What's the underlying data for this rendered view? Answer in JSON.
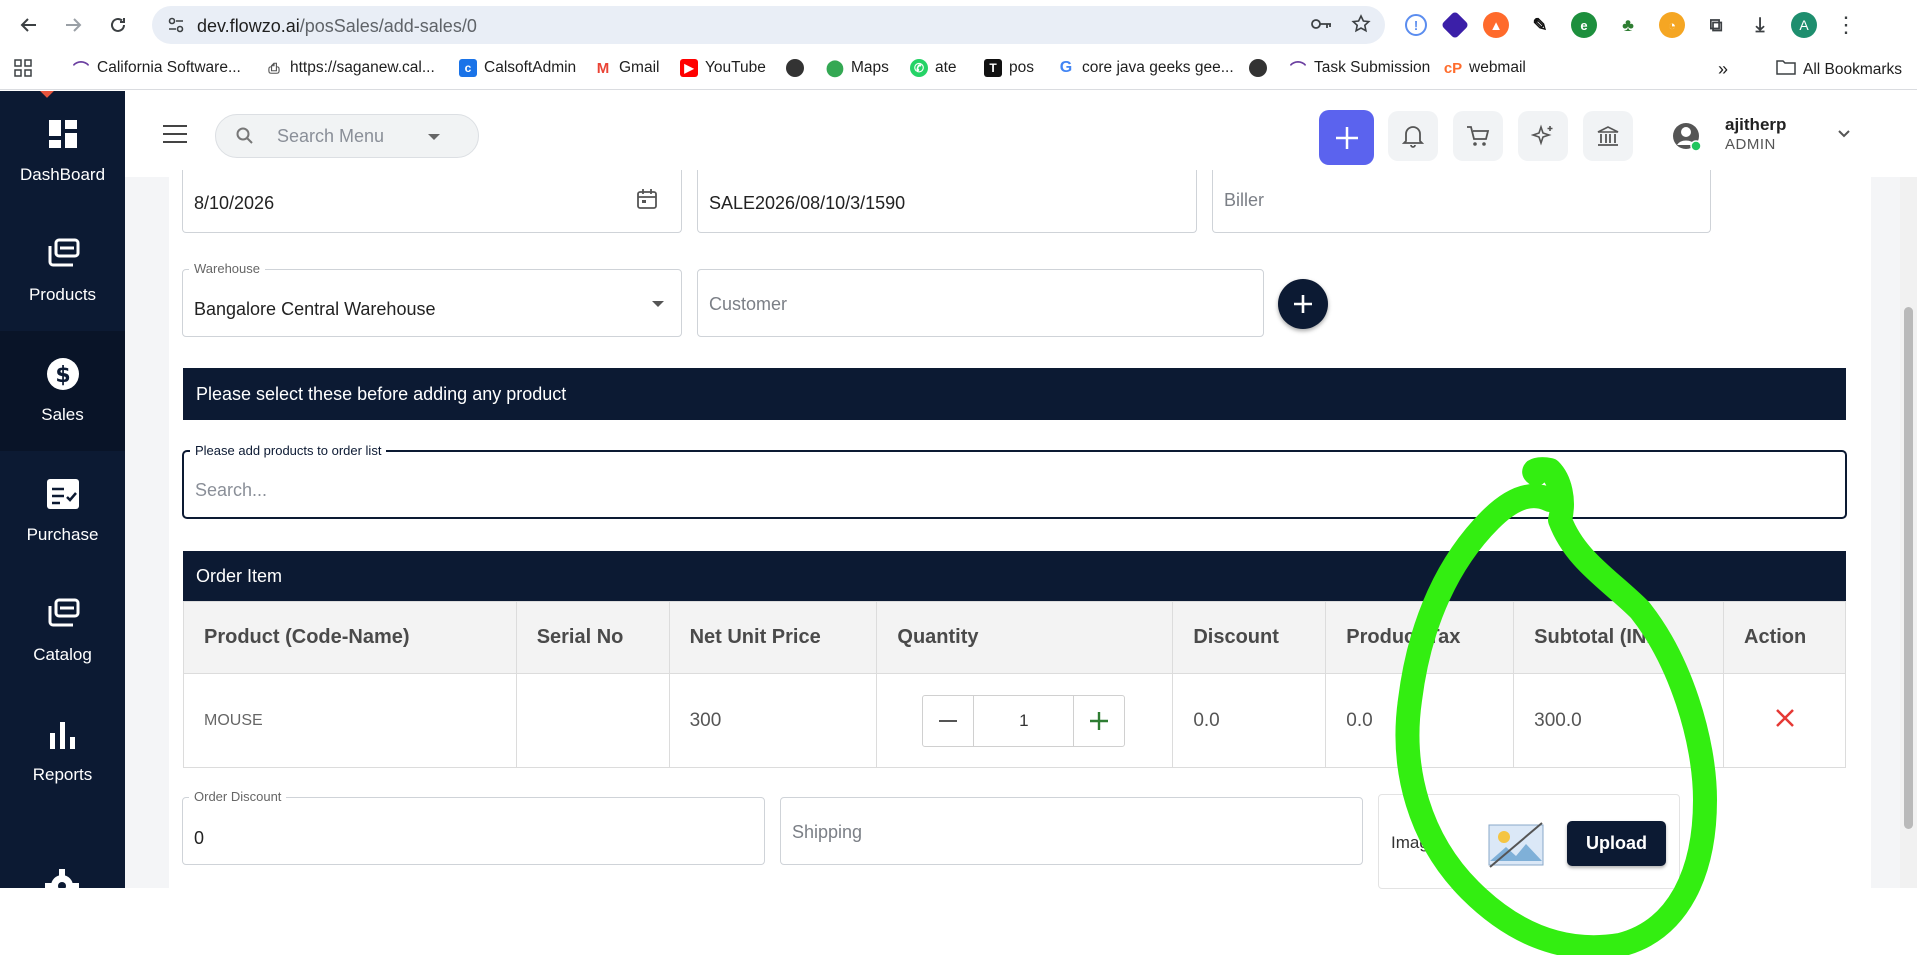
{
  "browser": {
    "url_host": "dev.flowzo.ai",
    "url_path": "/posSales/add-sales/0",
    "profile_initial": "A",
    "bookmarks": [
      {
        "label": "California Software...",
        "icon": "calsoft-arc-icon",
        "color": "#6b3fa0"
      },
      {
        "label": "https://saganew.cal...",
        "icon": "printer-icon",
        "color": "#555555"
      },
      {
        "label": "CalsoftAdmin",
        "icon": "bag-icon",
        "color": "#1a73e8"
      },
      {
        "label": "Gmail",
        "icon": "gmail-icon",
        "color": "#ea4335"
      },
      {
        "label": "YouTube",
        "icon": "youtube-icon",
        "color": "#ff0000"
      },
      {
        "label": "",
        "icon": "globe-icon",
        "color": "#333333"
      },
      {
        "label": "Maps",
        "icon": "maps-icon",
        "color": "#34a853"
      },
      {
        "label": "ate",
        "icon": "whatsapp-icon",
        "color": "#25d366"
      },
      {
        "label": "pos",
        "icon": "t-logo-icon",
        "color": "#111111"
      },
      {
        "label": "core java geeks gee...",
        "icon": "google-icon",
        "color": "#4285f4"
      },
      {
        "label": "",
        "icon": "globe-icon",
        "color": "#333333"
      },
      {
        "label": "Task Submission",
        "icon": "calsoft-arc-icon",
        "color": "#6b3fa0"
      },
      {
        "label": "webmail",
        "icon": "cpanel-icon",
        "color": "#ff6c2c"
      }
    ],
    "overflow_label": "»",
    "all_bookmarks_label": "All Bookmarks"
  },
  "sidebar": {
    "items": [
      {
        "label": "DashBoard",
        "icon": "dashboard-grid-icon"
      },
      {
        "label": "Products",
        "icon": "products-stack-icon"
      },
      {
        "label": "Sales",
        "icon": "dollar-circle-icon"
      },
      {
        "label": "Purchase",
        "icon": "checklist-icon"
      },
      {
        "label": "Catalog",
        "icon": "catalog-stack-icon"
      },
      {
        "label": "Reports",
        "icon": "bar-chart-icon"
      }
    ]
  },
  "header": {
    "search_placeholder": "Search Menu",
    "user_name": "ajitherp",
    "user_role": "ADMIN"
  },
  "form": {
    "date_value": "8/10/2026",
    "reference_value": "SALE2026/08/10/3/1590",
    "biller_placeholder": "Biller",
    "warehouse_label": "Warehouse",
    "warehouse_value": "Bangalore Central Warehouse",
    "customer_placeholder": "Customer",
    "notice": "Please select these before adding any product",
    "product_search_label": "Please add products to order list",
    "product_search_placeholder": "Search...",
    "order_item_title": "Order Item",
    "order_discount_label": "Order Discount",
    "order_discount_value": "0",
    "shipping_placeholder": "Shipping",
    "image_label": "Image",
    "upload_label": "Upload"
  },
  "order_table": {
    "headers": [
      "Product (Code-Name)",
      "Serial No",
      "Net Unit Price",
      "Quantity",
      "Discount",
      "Product Tax",
      "Subtotal (INR)",
      "Action"
    ],
    "rows": [
      {
        "product": "MOUSE",
        "serial": "",
        "price": "300",
        "quantity": "1",
        "discount": "0.0",
        "tax": "0.0",
        "subtotal": "300.0"
      }
    ]
  },
  "colors": {
    "navy": "#0c1a33",
    "accent_purple": "#5b63ee",
    "delete_red": "#e53935",
    "plus_green": "#2e7d32",
    "annotation_green": "#33ee11"
  }
}
